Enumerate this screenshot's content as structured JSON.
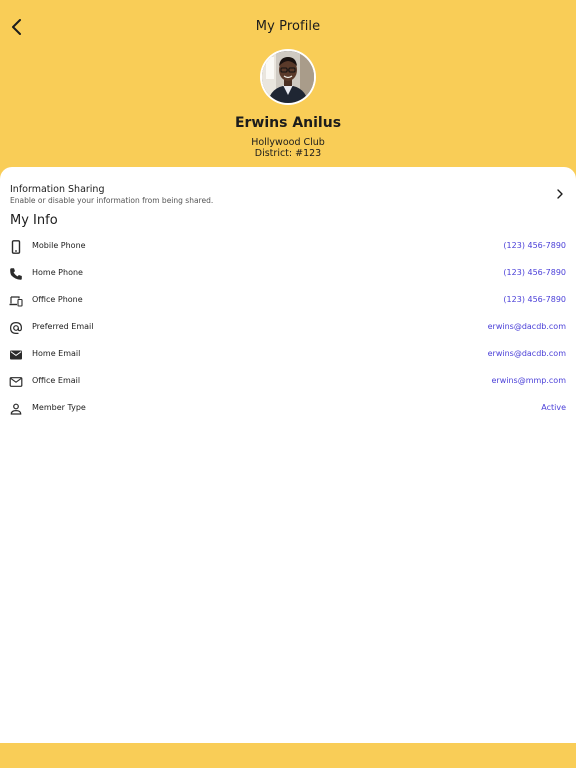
{
  "header": {
    "title": "My Profile",
    "back_icon": "chevron-left-icon"
  },
  "profile": {
    "name": "Erwins Anilus",
    "club": "Hollywood Club",
    "district": "District: #123"
  },
  "sharing": {
    "title": "Information Sharing",
    "subtitle": "Enable or disable your information from being shared.",
    "chevron_icon": "chevron-right-icon"
  },
  "my_info": {
    "title": "My Info",
    "rows": [
      {
        "icon": "mobile-phone-icon",
        "label": "Mobile Phone",
        "value": "(123) 456-7890"
      },
      {
        "icon": "phone-icon",
        "label": "Home Phone",
        "value": "(123) 456-7890"
      },
      {
        "icon": "devices-icon",
        "label": "Office Phone",
        "value": "(123) 456-7890"
      },
      {
        "icon": "at-sign-icon",
        "label": "Preferred Email",
        "value": "erwins@dacdb.com"
      },
      {
        "icon": "mail-filled-icon",
        "label": "Home Email",
        "value": "erwins@dacdb.com"
      },
      {
        "icon": "mail-outline-icon",
        "label": "Office Email",
        "value": "erwins@mmp.com"
      },
      {
        "icon": "person-icon",
        "label": "Member Type",
        "value": "Active"
      }
    ]
  },
  "colors": {
    "background": "#f9cd57",
    "card": "#ffffff",
    "link": "#4a3fd8",
    "text": "#1c1c1c"
  }
}
